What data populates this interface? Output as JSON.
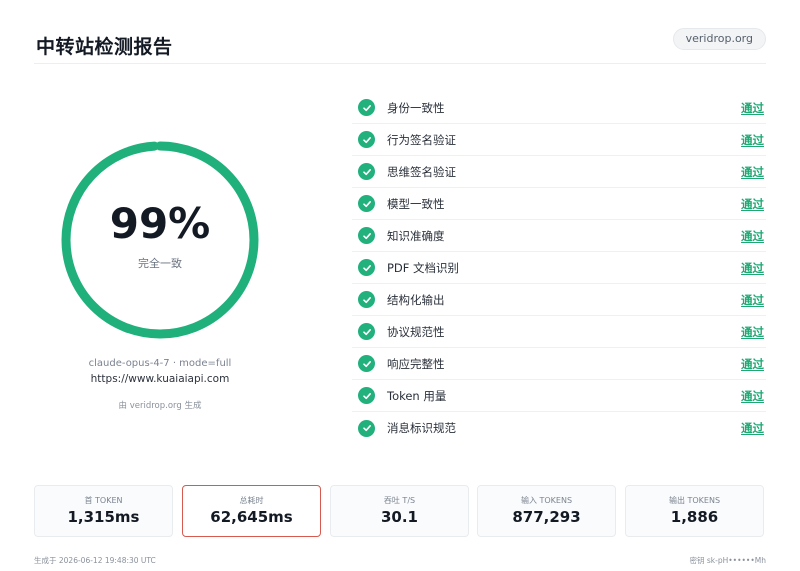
{
  "header": {
    "title": "中转站检测报告",
    "site_badge": "veridrop.org"
  },
  "summary": {
    "score_text": "99%",
    "score_fraction": 0.99,
    "score_label": "完全一致",
    "ring_color": "#1fb07b",
    "model_mode": "claude-opus-4-7 · mode=full",
    "url": "https://www.kuaiaiapi.com",
    "generated_by": "由 veridrop.org 生成"
  },
  "checks": [
    {
      "label": "身份一致性",
      "status": "通过"
    },
    {
      "label": "行为签名验证",
      "status": "通过"
    },
    {
      "label": "思维签名验证",
      "status": "通过"
    },
    {
      "label": "模型一致性",
      "status": "通过"
    },
    {
      "label": "知识准确度",
      "status": "通过"
    },
    {
      "label": "PDF 文档识别",
      "status": "通过"
    },
    {
      "label": "结构化输出",
      "status": "通过"
    },
    {
      "label": "协议规范性",
      "status": "通过"
    },
    {
      "label": "响应完整性",
      "status": "通过"
    },
    {
      "label": "Token 用量",
      "status": "通过"
    },
    {
      "label": "消息标识规范",
      "status": "通过"
    }
  ],
  "stats": [
    {
      "label": "首 TOKEN",
      "value": "1,315ms"
    },
    {
      "label": "总耗时",
      "value": "62,645ms"
    },
    {
      "label": "吞吐 T/S",
      "value": "30.1"
    },
    {
      "label": "输入 TOKENS",
      "value": "877,293"
    },
    {
      "label": "输出 TOKENS",
      "value": "1,886"
    }
  ],
  "footer": {
    "generated_at": "生成于 2026-06-12 19:48:30 UTC",
    "key": "密钥 sk-pH••••••Mh"
  },
  "colors": {
    "pass_green": "#1fa874",
    "highlight_border": "#d65a50"
  }
}
